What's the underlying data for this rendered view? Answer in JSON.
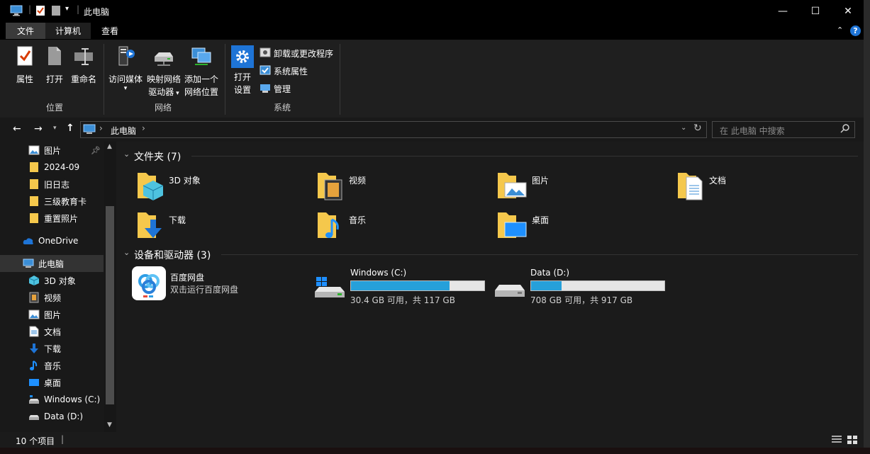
{
  "window": {
    "title": "此电脑",
    "minimize_glyph": "—",
    "maximize_glyph": "☐",
    "close_glyph": "✕"
  },
  "ribbon_tabs": [
    {
      "label": "文件"
    },
    {
      "label": "计算机"
    },
    {
      "label": "查看"
    }
  ],
  "ribbon": {
    "location_group": {
      "label": "位置",
      "properties": "属性",
      "open": "打开",
      "rename": "重命名"
    },
    "network_group": {
      "label": "网络",
      "access_media": "访问媒体",
      "map_drive_line1": "映射网络",
      "map_drive_line2": "驱动器",
      "add_location_line1": "添加一个",
      "add_location_line2": "网络位置"
    },
    "system_group": {
      "label": "系统",
      "open_settings_line1": "打开",
      "open_settings_line2": "设置",
      "uninstall": "卸载或更改程序",
      "system_properties": "系统属性",
      "manage": "管理"
    }
  },
  "address": {
    "path": "此电脑",
    "search_placeholder": "在 此电脑 中搜索"
  },
  "nav_pane": {
    "quick_access": [
      {
        "label": "图片",
        "pinned": true
      },
      {
        "label": "2024-09"
      },
      {
        "label": "旧日志"
      },
      {
        "label": "三级教育卡"
      },
      {
        "label": "重置照片"
      }
    ],
    "onedrive": "OneDrive",
    "this_pc": "此电脑",
    "pc_items": [
      {
        "label": "3D 对象"
      },
      {
        "label": "视频"
      },
      {
        "label": "图片"
      },
      {
        "label": "文档"
      },
      {
        "label": "下载"
      },
      {
        "label": "音乐"
      },
      {
        "label": "桌面"
      },
      {
        "label": "Windows (C:)"
      },
      {
        "label": "Data (D:)"
      }
    ]
  },
  "folders_section": {
    "header": "文件夹 (7)",
    "items": [
      {
        "label": "3D 对象"
      },
      {
        "label": "视频"
      },
      {
        "label": "图片"
      },
      {
        "label": "文档"
      },
      {
        "label": "下载"
      },
      {
        "label": "音乐"
      },
      {
        "label": "桌面"
      }
    ]
  },
  "devices_section": {
    "header": "设备和驱动器 (3)",
    "baidu": {
      "name": "百度网盘",
      "subtitle": "双击运行百度网盘"
    },
    "drives": [
      {
        "name": "Windows (C:)",
        "info": "30.4 GB 可用，共 117 GB",
        "used_fraction": 0.74
      },
      {
        "name": "Data (D:)",
        "info": "708 GB 可用，共 917 GB",
        "used_fraction": 0.23
      }
    ]
  },
  "status": {
    "item_count": "10 个项目"
  },
  "colors": {
    "accent": "#26a0da",
    "folder": "#f5c84c",
    "background": "#1b1b1b"
  }
}
